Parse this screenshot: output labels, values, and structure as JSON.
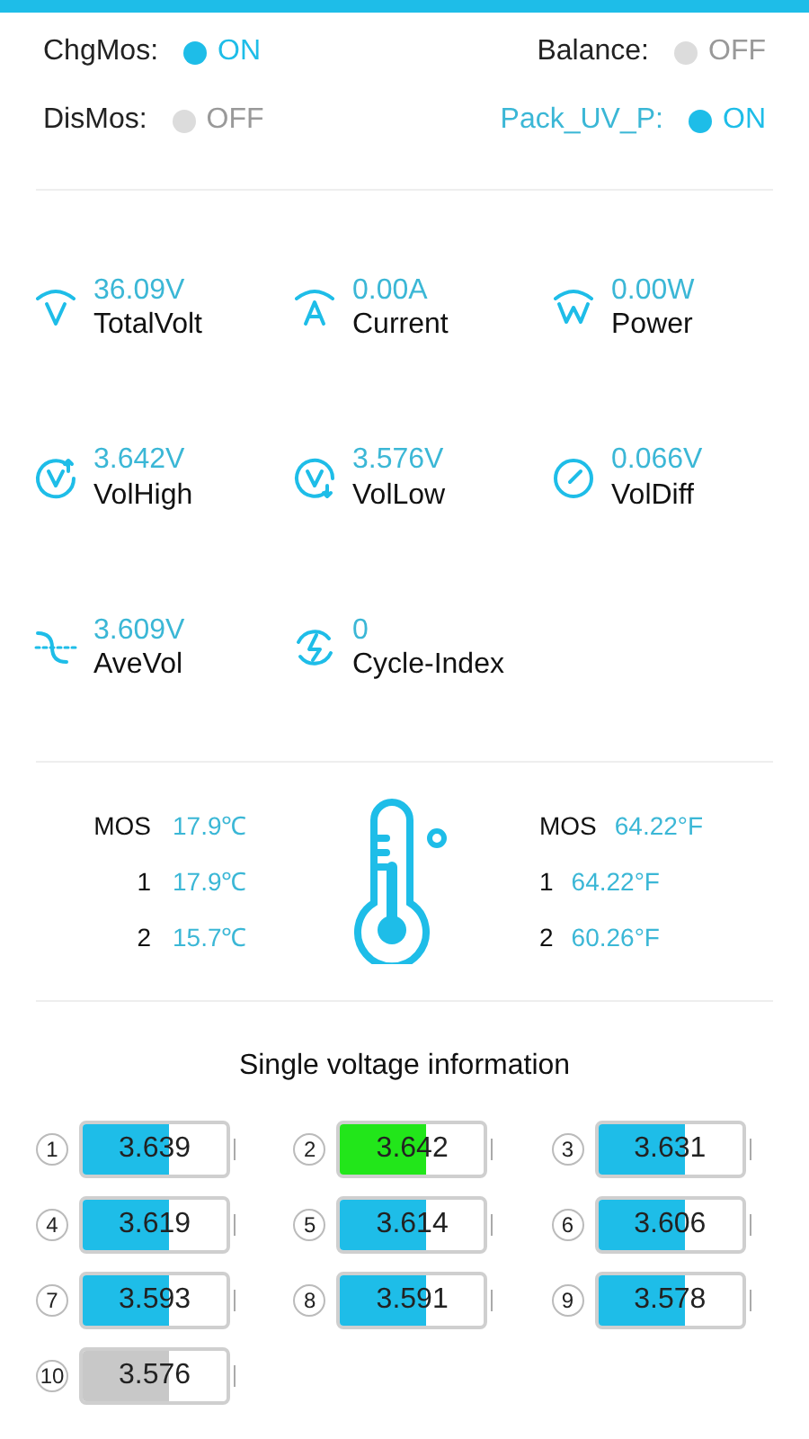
{
  "switches": [
    {
      "label": "ChgMos:",
      "on": true,
      "alarm": false,
      "state_text": "ON"
    },
    {
      "label": "Balance:",
      "on": false,
      "alarm": false,
      "state_text": "OFF"
    },
    {
      "label": "DisMos:",
      "on": false,
      "alarm": false,
      "state_text": "OFF"
    },
    {
      "label": "Pack_UV_P:",
      "on": true,
      "alarm": true,
      "state_text": "ON"
    }
  ],
  "metrics": [
    {
      "value": "36.09V",
      "label": "TotalVolt"
    },
    {
      "value": "0.00A",
      "label": "Current"
    },
    {
      "value": "0.00W",
      "label": "Power"
    },
    {
      "value": "3.642V",
      "label": "VolHigh"
    },
    {
      "value": "3.576V",
      "label": "VolLow"
    },
    {
      "value": "0.066V",
      "label": "VolDiff"
    },
    {
      "value": "3.609V",
      "label": "AveVol"
    },
    {
      "value": "0",
      "label": "Cycle-Index"
    }
  ],
  "temperatures_c": [
    {
      "name": "MOS",
      "value": "17.9℃"
    },
    {
      "name": "1",
      "value": "17.9℃"
    },
    {
      "name": "2",
      "value": "15.7℃"
    }
  ],
  "temperatures_f": [
    {
      "name": "MOS",
      "value": "64.22°F"
    },
    {
      "name": "1",
      "value": "64.22°F"
    },
    {
      "name": "2",
      "value": "60.26°F"
    }
  ],
  "cells_title": "Single voltage information",
  "cells": [
    {
      "index": "1",
      "voltage": "3.639",
      "level": 0.6,
      "color": "#1ebde8"
    },
    {
      "index": "2",
      "voltage": "3.642",
      "level": 0.6,
      "color": "#22e61a"
    },
    {
      "index": "3",
      "voltage": "3.631",
      "level": 0.6,
      "color": "#1ebde8"
    },
    {
      "index": "4",
      "voltage": "3.619",
      "level": 0.6,
      "color": "#1ebde8"
    },
    {
      "index": "5",
      "voltage": "3.614",
      "level": 0.6,
      "color": "#1ebde8"
    },
    {
      "index": "6",
      "voltage": "3.606",
      "level": 0.6,
      "color": "#1ebde8"
    },
    {
      "index": "7",
      "voltage": "3.593",
      "level": 0.6,
      "color": "#1ebde8"
    },
    {
      "index": "8",
      "voltage": "3.591",
      "level": 0.6,
      "color": "#1ebde8"
    },
    {
      "index": "9",
      "voltage": "3.578",
      "level": 0.6,
      "color": "#1ebde8"
    },
    {
      "index": "10",
      "voltage": "3.576",
      "level": 0.6,
      "color": "#c8c8c8"
    }
  ]
}
